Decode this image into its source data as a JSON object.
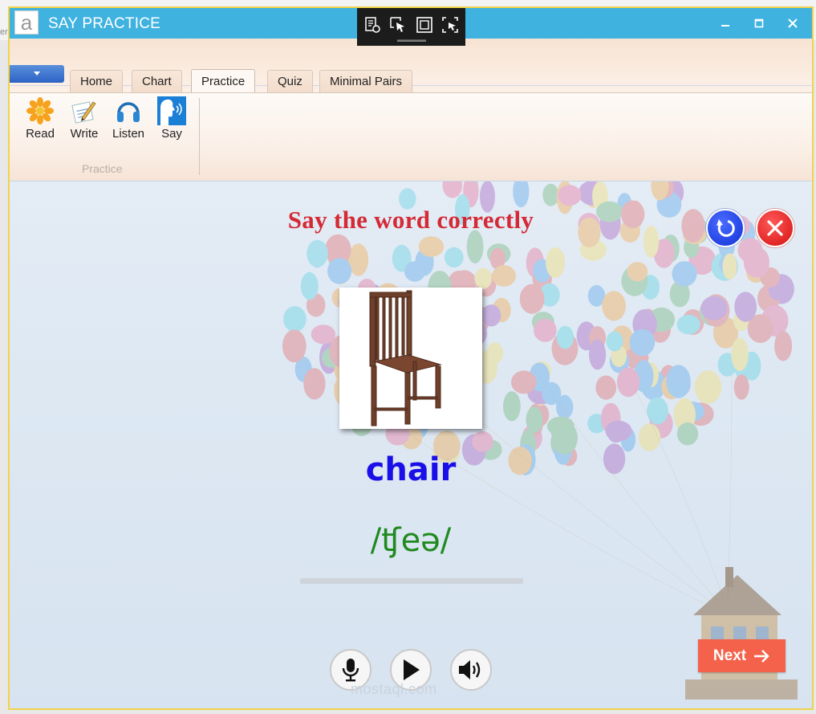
{
  "background": {
    "ghost_text": "er"
  },
  "window": {
    "app_icon_letter": "a",
    "title": "SAY PRACTICE",
    "controls": [
      "minimize-icon",
      "maximize-icon",
      "close-icon"
    ]
  },
  "overlay_toolbar": {
    "icons": [
      "inspect-settings-icon",
      "select-pointer-icon",
      "fullscreen-icon",
      "screen-select-icon"
    ]
  },
  "ribbon": {
    "tabs": [
      {
        "label": "Home"
      },
      {
        "label": "Chart"
      },
      {
        "label": "Practice",
        "active": true
      },
      {
        "label": "Quiz"
      },
      {
        "label": "Minimal Pairs"
      }
    ],
    "buttons": [
      {
        "label": "Read",
        "icon": "read-flower-icon"
      },
      {
        "label": "Write",
        "icon": "write-pencil-icon"
      },
      {
        "label": "Listen",
        "icon": "headphones-icon"
      },
      {
        "label": "Say",
        "icon": "speaking-face-icon"
      }
    ],
    "group_label": "Practice"
  },
  "practice": {
    "title": "Say the word correctly",
    "image_subject": "chair",
    "word": "chair",
    "ipa": "/ʧeə/",
    "progress": 0,
    "next_label": "Next",
    "media_buttons": [
      "microphone-icon",
      "play-icon",
      "speaker-icon"
    ],
    "watermark": "mostaql.com"
  },
  "colors": {
    "titlebar": "#3fb2e0",
    "title_text": "#d42a36",
    "word": "#1a0fe8",
    "ipa": "#208a20",
    "next_button": "#f5624b"
  }
}
